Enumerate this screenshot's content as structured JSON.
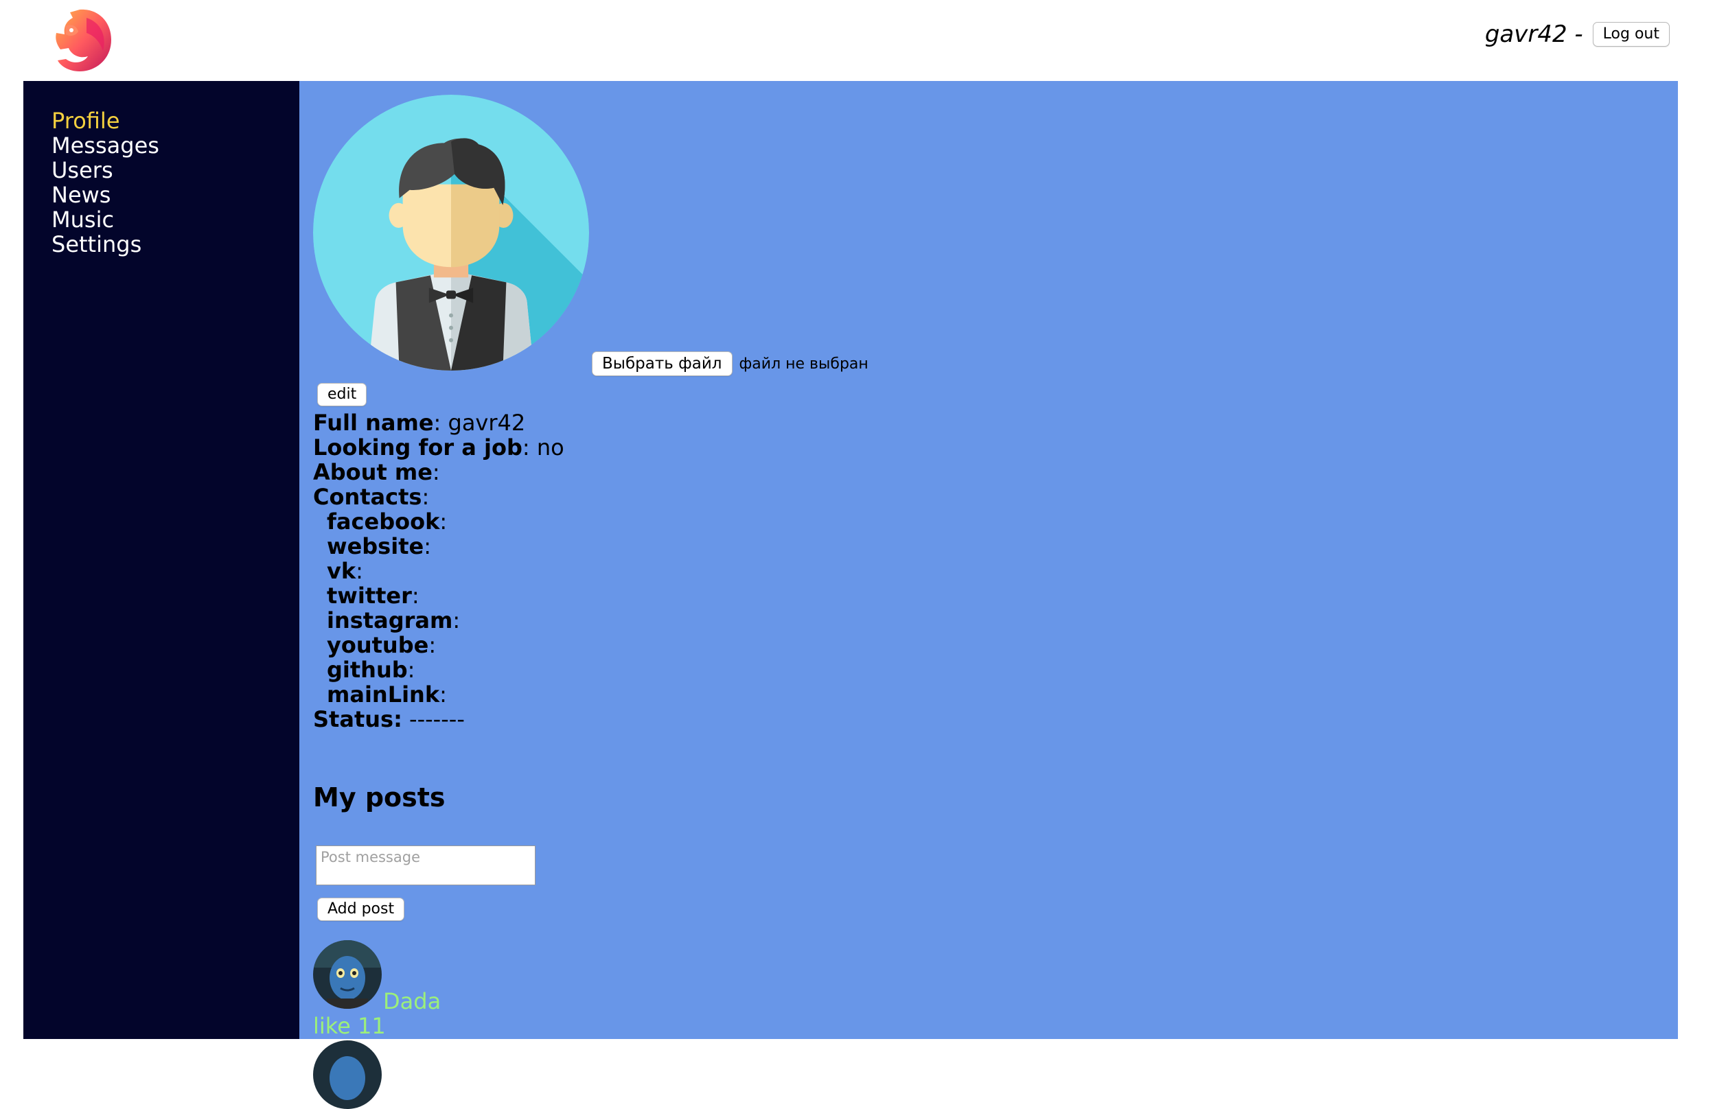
{
  "header": {
    "login_name": "gavr42 -",
    "logout_label": "Log out"
  },
  "sidebar": {
    "items": [
      {
        "label": "Profile",
        "active": true
      },
      {
        "label": "Messages"
      },
      {
        "label": "Users"
      },
      {
        "label": "News"
      },
      {
        "label": "Music"
      },
      {
        "label": "Settings"
      }
    ]
  },
  "profile": {
    "choose_file_label": "Выбрать файл",
    "file_status": "файл не выбран",
    "edit_label": "edit",
    "full_name_label": "Full name",
    "full_name": "gavr42",
    "job_label": "Looking for a job",
    "job_value": "no",
    "about_label": "About me",
    "contacts_label": "Contacts",
    "contacts": [
      {
        "label": "facebook"
      },
      {
        "label": "website"
      },
      {
        "label": "vk"
      },
      {
        "label": "twitter"
      },
      {
        "label": "instagram"
      },
      {
        "label": "youtube"
      },
      {
        "label": "github"
      },
      {
        "label": "mainLink"
      }
    ],
    "status_label": "Status:",
    "status_value": "-------"
  },
  "posts": {
    "title": "My posts",
    "placeholder": "Post message",
    "add_label": "Add post",
    "items": [
      {
        "author": "Dada",
        "likes": "like 11"
      }
    ]
  },
  "colors": {
    "sidebar_bg": "#03052b",
    "content_bg": "#6896e8",
    "active_nav": "#f4d03f",
    "post_text": "#9cf07a"
  },
  "icons": {
    "logo": "lion-logo-icon",
    "avatar": "user-avatar-icon"
  }
}
